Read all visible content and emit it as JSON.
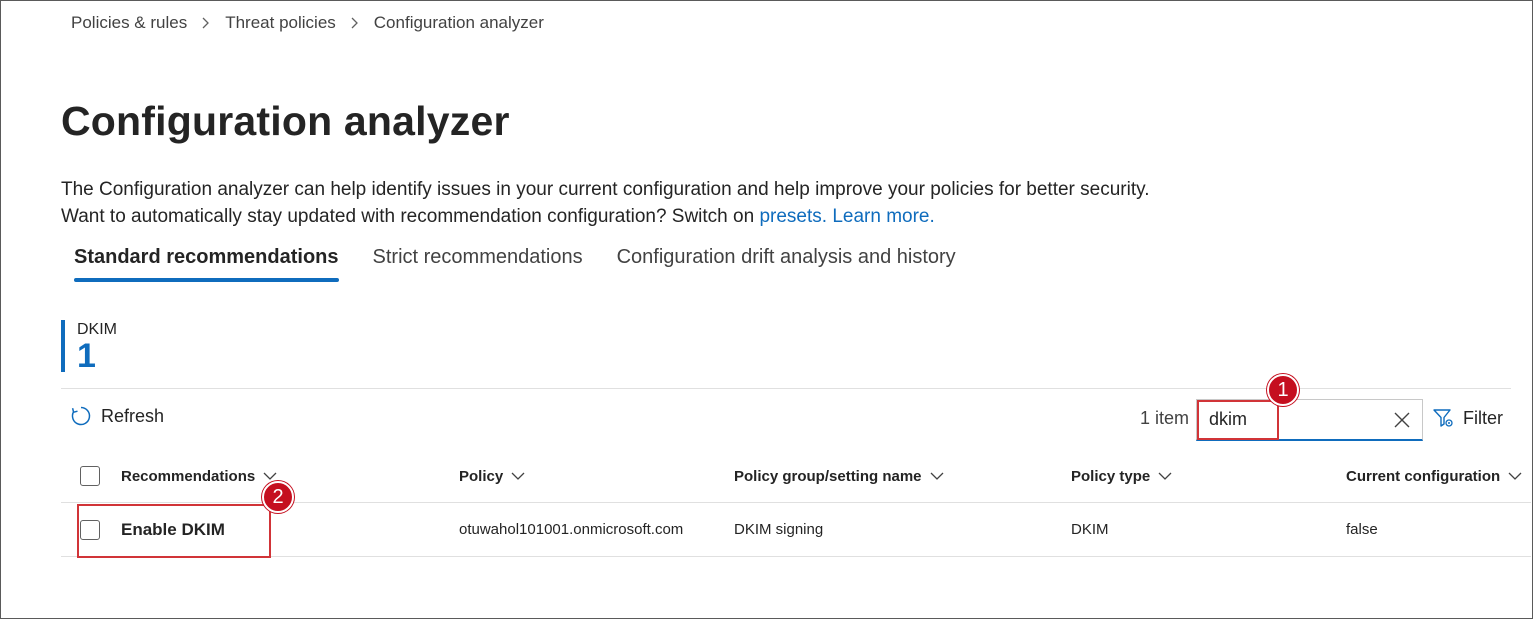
{
  "breadcrumb": {
    "items": [
      "Policies & rules",
      "Threat policies",
      "Configuration analyzer"
    ]
  },
  "page": {
    "title": "Configuration analyzer",
    "description_text": "The Configuration analyzer can help identify issues in your current configuration and help improve your policies for better security. Want to automatically stay updated with recommendation configuration? Switch on",
    "description_link_presets": "presets.",
    "description_link_learn": "Learn more."
  },
  "tabs": [
    {
      "label": "Standard recommendations",
      "active": true
    },
    {
      "label": "Strict recommendations",
      "active": false
    },
    {
      "label": "Configuration drift analysis and history",
      "active": false
    }
  ],
  "metric": {
    "label": "DKIM",
    "value": "1"
  },
  "toolbar": {
    "refresh_label": "Refresh",
    "item_count": "1 item",
    "search_value": "dkim",
    "filter_label": "Filter"
  },
  "table": {
    "columns": [
      "Recommendations",
      "Policy",
      "Policy group/setting name",
      "Policy type",
      "Current configuration"
    ],
    "rows": [
      {
        "recommendation": "Enable DKIM",
        "policy": "otuwahol101001.onmicrosoft.com",
        "group": "DKIM signing",
        "type": "DKIM",
        "current": "false"
      }
    ]
  },
  "annotations": {
    "badge_1": "1",
    "badge_2": "2"
  },
  "colors": {
    "accent": "#0f6cbd",
    "annotation": "#d13438",
    "badge": "#c50f1f"
  },
  "icons": [
    "chevron-right-icon",
    "refresh-icon",
    "close-icon",
    "filter-icon",
    "chevron-down-icon"
  ]
}
